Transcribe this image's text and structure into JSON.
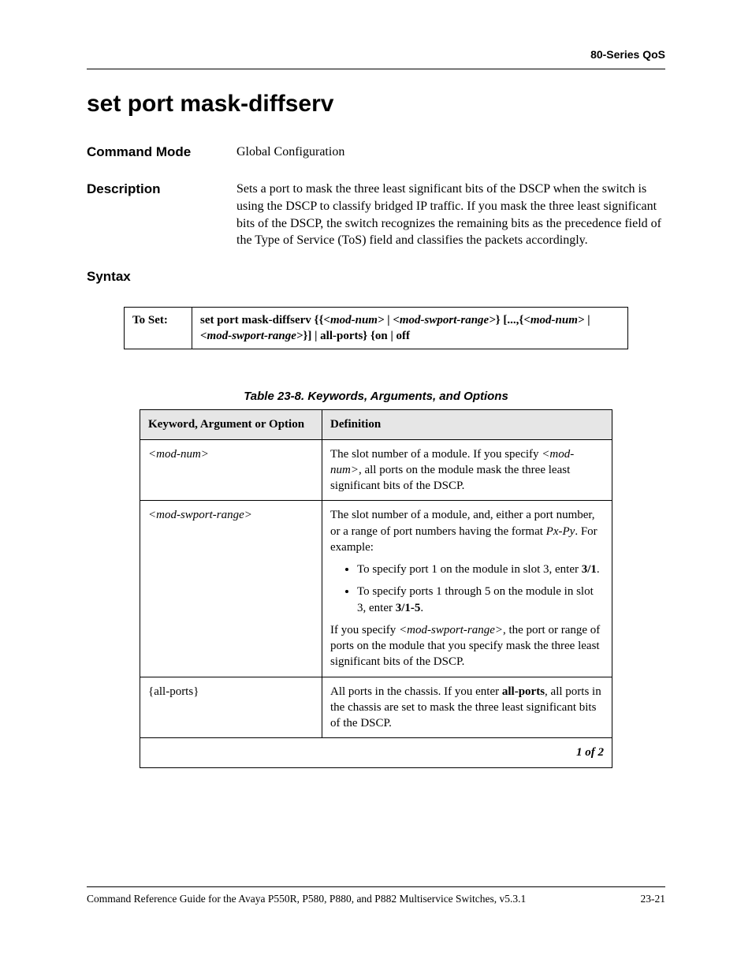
{
  "header": {
    "right": "80-Series QoS"
  },
  "title": "set port mask-diffserv",
  "command_mode": {
    "label": "Command Mode",
    "value": "Global Configuration"
  },
  "description": {
    "label": "Description",
    "text": "Sets a port to mask the three least significant bits of the DSCP when the switch is using the DSCP to classify bridged IP traffic. If you mask the three least significant bits of the DSCP, the switch recognizes the remaining bits as the precedence field of the Type of Service (ToS) field and classifies the packets accordingly."
  },
  "syntax": {
    "label": "Syntax",
    "to_set_label": "To Set:",
    "to_set_prefix": "set port mask-diffserv {{",
    "arg1": "<mod-num>",
    "sep1": " | ",
    "arg2": "<mod-swport-range>",
    "mid": "} [...,{",
    "arg3": "<mod-num>",
    "sep2": " | ",
    "arg4": "<mod-swport-range>",
    "suffix": "}] | all-ports} {on | off"
  },
  "args_table": {
    "caption": "Table 23-8. Keywords, Arguments, and Options",
    "head_keyword": "Keyword, Argument or Option",
    "head_def": "Definition",
    "row1": {
      "kw": "<mod-num>",
      "p1a": "The slot number of a module. If you specify ",
      "p1b": "<mod-num>",
      "p1c": ", all ports on the module mask the three least significant bits of the DSCP."
    },
    "row2": {
      "kw": "<mod-swport-range>",
      "p1a": "The slot number of a module, and, either a port number, or a range of port numbers having the format ",
      "p1b": "Px-Py",
      "p1c": ". For example:",
      "li1a": "To specify port 1 on the module in slot 3, enter ",
      "li1b": "3/1",
      "li1c": ".",
      "li2a": "To specify ports 1 through 5 on the module in slot 3, enter ",
      "li2b": "3/1-5",
      "li2c": ".",
      "p2a": "If you specify ",
      "p2b": "<mod-swport-range>",
      "p2c": ", the port or range of ports on the module that you specify mask the three least significant bits of the DSCP."
    },
    "row3": {
      "kw": "{all-ports}",
      "p1a": "All ports in the chassis. If you enter ",
      "p1b": "all-ports",
      "p1c": ", all ports in the chassis are set to mask the three least significant bits of the DSCP."
    },
    "pager": "1 of 2"
  },
  "footer": {
    "left": "Command Reference Guide for the Avaya P550R, P580, P880, and P882 Multiservice Switches, v5.3.1",
    "right": "23-21"
  }
}
